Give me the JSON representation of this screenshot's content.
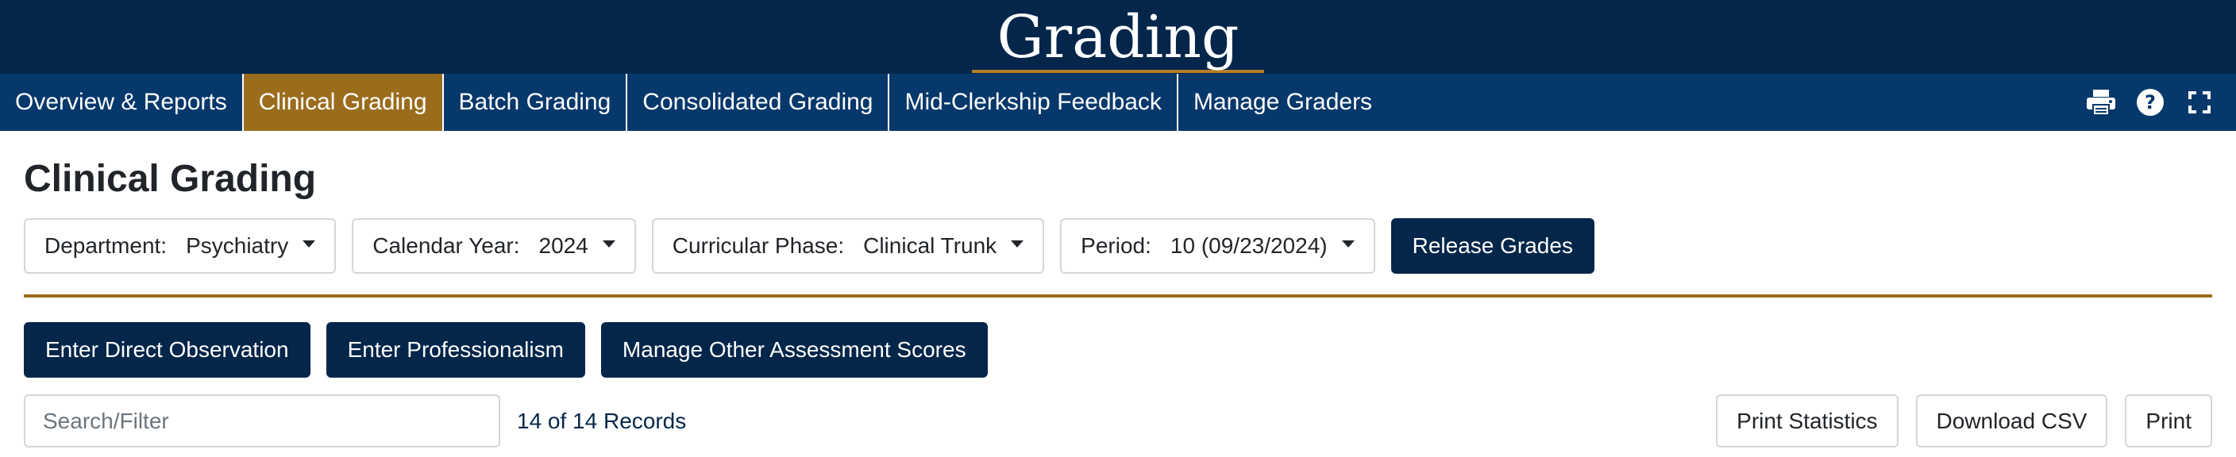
{
  "header": {
    "title": "Grading"
  },
  "nav": {
    "tabs": [
      {
        "label": "Overview & Reports",
        "active": false
      },
      {
        "label": "Clinical Grading",
        "active": true
      },
      {
        "label": "Batch Grading",
        "active": false
      },
      {
        "label": "Consolidated Grading",
        "active": false
      },
      {
        "label": "Mid-Clerkship Feedback",
        "active": false
      },
      {
        "label": "Manage Graders",
        "active": false
      }
    ],
    "icons": [
      "printer-icon",
      "help-icon",
      "fullscreen-icon"
    ]
  },
  "page": {
    "title": "Clinical Grading"
  },
  "filters": [
    {
      "label": "Department:",
      "value": "Psychiatry"
    },
    {
      "label": "Calendar Year:",
      "value": "2024"
    },
    {
      "label": "Curricular Phase:",
      "value": "Clinical Trunk"
    },
    {
      "label": "Period:",
      "value": "10 (09/23/2024)"
    }
  ],
  "release_button": "Release Grades",
  "actions": [
    "Enter Direct Observation",
    "Enter Professionalism",
    "Manage Other Assessment Scores"
  ],
  "search": {
    "placeholder": "Search/Filter",
    "value": ""
  },
  "records": "14 of 14 Records",
  "toolbar_buttons": [
    "Print Statistics",
    "Download CSV",
    "Print"
  ],
  "colors": {
    "header_bg": "#03264a",
    "nav_bg": "#07386b",
    "accent_gold": "#9a6d1d",
    "button_dark": "#03264a"
  }
}
